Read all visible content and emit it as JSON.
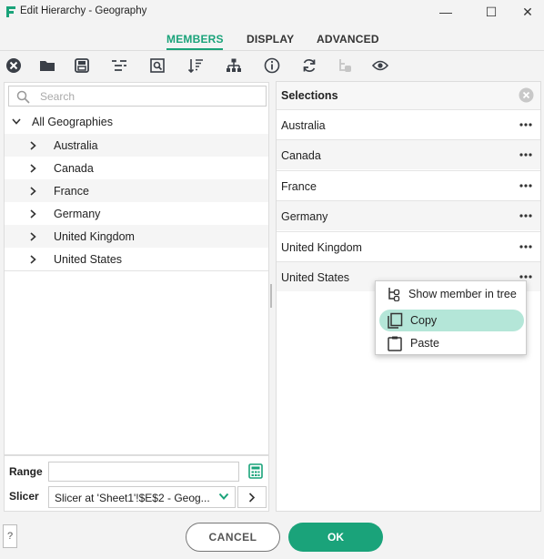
{
  "window": {
    "title": "Edit Hierarchy - Geography",
    "controls": {
      "minimize": "—",
      "maximize": "☐",
      "close": "✕"
    }
  },
  "tabs": [
    {
      "label": "MEMBERS",
      "active": true
    },
    {
      "label": "DISPLAY",
      "active": false
    },
    {
      "label": "ADVANCED",
      "active": false
    }
  ],
  "toolbar": {
    "icons": [
      "clear-icon",
      "folder-icon",
      "save-icon",
      "indent-icon",
      "search-member-icon",
      "sort-icon",
      "hierarchy-icon",
      "info-icon",
      "refresh-icon",
      "hierarchy-disabled-icon",
      "view-icon"
    ]
  },
  "search": {
    "placeholder": "Search",
    "value": ""
  },
  "tree": {
    "root": "All Geographies",
    "items": [
      "Australia",
      "Canada",
      "France",
      "Germany",
      "United Kingdom",
      "United States"
    ]
  },
  "selections": {
    "title": "Selections",
    "items": [
      "Australia",
      "Canada",
      "France",
      "Germany",
      "United Kingdom",
      "United States"
    ]
  },
  "context_menu": {
    "items": [
      {
        "label": "Show member in tree",
        "icon": "tree-icon"
      },
      {
        "label": "Copy",
        "icon": "copy-icon",
        "highlighted": true
      },
      {
        "label": "Paste",
        "icon": "paste-icon"
      }
    ]
  },
  "range": {
    "label": "Range",
    "value": ""
  },
  "slicer": {
    "label": "Slicer",
    "value": "Slicer at 'Sheet1'!$E$2 - Geog..."
  },
  "footer": {
    "help": "?",
    "cancel": "CANCEL",
    "ok": "OK"
  },
  "colors": {
    "accent": "#1aa37a",
    "highlight": "#b4e6d8"
  }
}
